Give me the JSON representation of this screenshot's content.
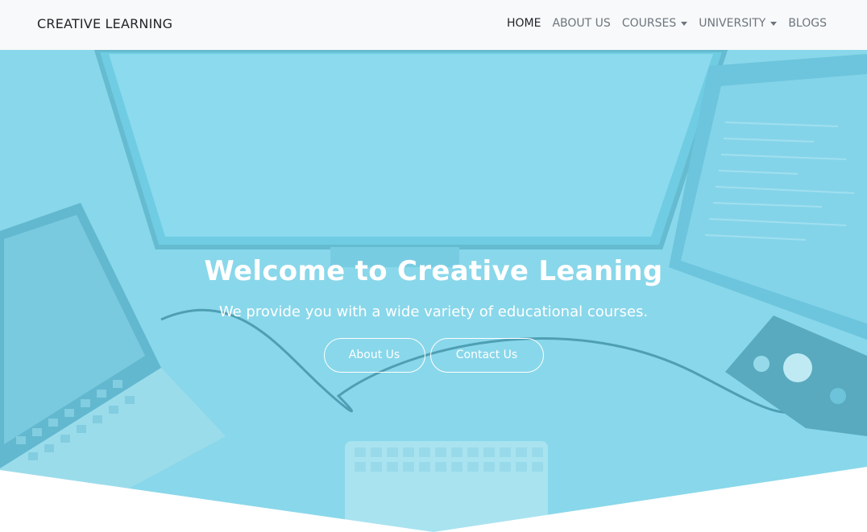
{
  "navbar": {
    "brand": "CREATIVE LEARNING",
    "items": [
      {
        "label": "HOME",
        "active": true
      },
      {
        "label": "ABOUT US"
      },
      {
        "label": "COURSES",
        "dropdown": true
      },
      {
        "label": "UNIVERSITY",
        "dropdown": true
      },
      {
        "label": "BLOGS"
      }
    ]
  },
  "hero": {
    "title": "Welcome to Creative Leaning",
    "subtitle": "We provide you with a wide variety of educational courses.",
    "buttons": {
      "about": "About Us",
      "contact": "Contact Us"
    }
  },
  "colors": {
    "overlay": "#7fd2e6",
    "navbar_bg": "#f8f9fa",
    "nav_active": "#212529",
    "nav_inactive": "#6c757d"
  }
}
